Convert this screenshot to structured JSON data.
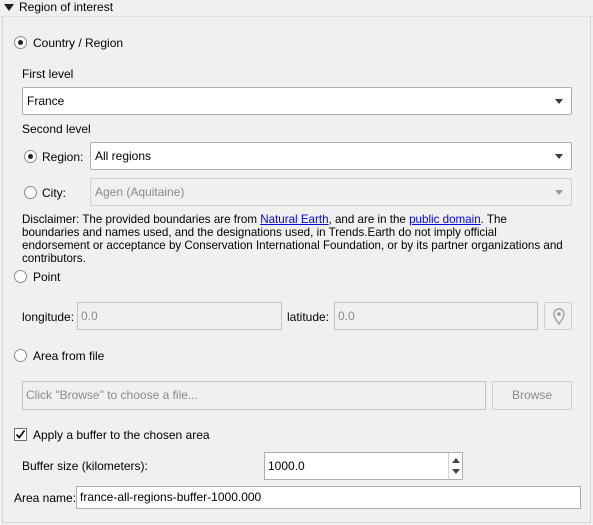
{
  "section": {
    "title": "Region of interest"
  },
  "country_region": {
    "radio_label": "Country / Region",
    "first_level_label": "First level",
    "first_level_value": "France",
    "second_level_label": "Second level",
    "region_label": "Region:",
    "region_value": "All regions",
    "city_label": "City:",
    "city_value": "Agen (Aquitaine)",
    "disclaimer": {
      "part1": "Disclaimer: The provided boundaries are from ",
      "link1": "Natural Earth",
      "part2": ", and are in the ",
      "link2": "public domain",
      "part3": ". The boundaries and names used, and the designations used, in Trends.Earth do not imply official endorsement or acceptance by Conservation International Foundation, or by its partner organizations and contributors."
    }
  },
  "point": {
    "radio_label": "Point",
    "longitude_label": "longitude:",
    "longitude_value": "0.0",
    "latitude_label": "latitude:",
    "latitude_value": "0.0",
    "pick_icon": "map-pin-icon"
  },
  "area_file": {
    "radio_label": "Area from file",
    "placeholder": "Click \"Browse\" to choose a file...",
    "browse_label": "Browse"
  },
  "buffer": {
    "checkbox_label": "Apply a buffer to the chosen area",
    "checked": true,
    "size_label": "Buffer size (kilometers):",
    "size_value": "1000.0"
  },
  "area_name": {
    "label": "Area name:",
    "value": "france-all-regions-buffer-1000.000"
  }
}
